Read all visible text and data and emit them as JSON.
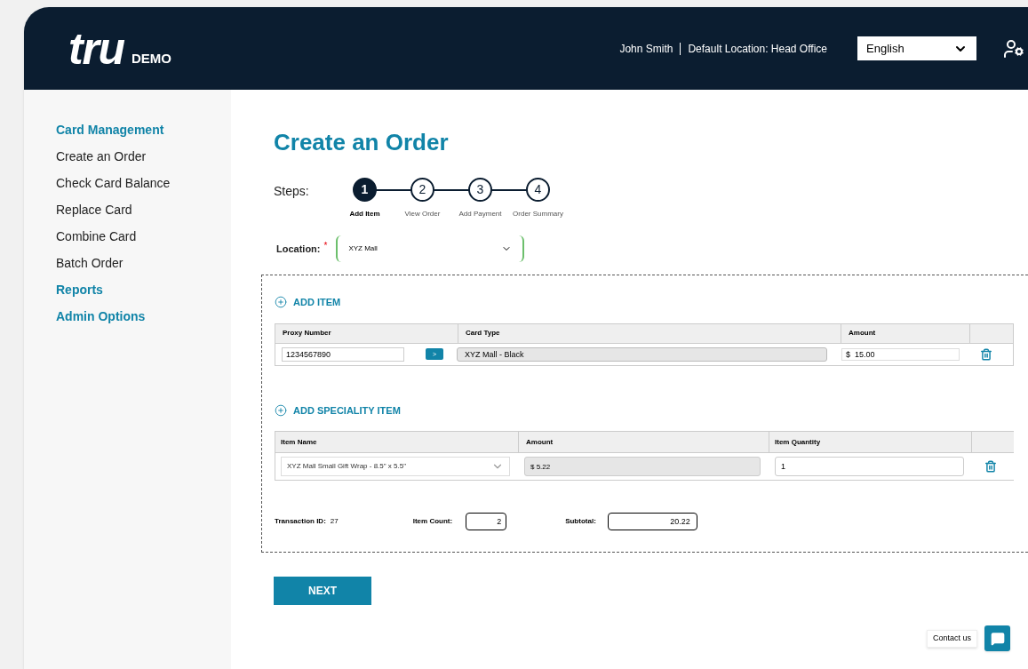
{
  "header": {
    "logo": "tru",
    "logo_sub": "DEMO",
    "user": "John Smith",
    "location_label": "Default Location:",
    "location": "Head Office",
    "language": "English"
  },
  "sidebar": {
    "items": [
      {
        "label": "Card Management",
        "kind": "heading"
      },
      {
        "label": "Create an Order",
        "kind": "link"
      },
      {
        "label": "Check Card Balance",
        "kind": "link"
      },
      {
        "label": "Replace Card",
        "kind": "link"
      },
      {
        "label": "Combine Card",
        "kind": "link"
      },
      {
        "label": "Batch Order",
        "kind": "link"
      },
      {
        "label": "Reports",
        "kind": "heading"
      },
      {
        "label": "Admin Options",
        "kind": "heading"
      }
    ]
  },
  "page_title": "Create an Order",
  "steps": {
    "label": "Steps:",
    "items": [
      {
        "number": "1",
        "label": "Add Item",
        "selected": true
      },
      {
        "number": "2",
        "label": "View Order",
        "selected": false
      },
      {
        "number": "3",
        "label": "Add Payment",
        "selected": false
      },
      {
        "number": "4",
        "label": "Order Summary",
        "selected": false
      }
    ]
  },
  "location": {
    "label": "Location:",
    "required_mark": "*",
    "value": "XYZ Mall"
  },
  "add_item": {
    "title": "ADD ITEM",
    "columns": [
      "Proxy Number",
      "Card Type",
      "Amount"
    ],
    "go_button": ">",
    "rows": [
      {
        "proxy_number": "1234567890",
        "card_type": "XYZ Mall - Black",
        "amount": "$  15.00"
      }
    ]
  },
  "add_speciality_item": {
    "title": "ADD SPECIALITY ITEM",
    "columns": [
      "Item Name",
      "Amount",
      "Item Quantity"
    ],
    "rows": [
      {
        "item_name": "XYZ Mall Small Gift Wrap - 8.5\" x 5.5\"",
        "amount": "$ 5.22",
        "quantity": "1"
      }
    ]
  },
  "totals": {
    "transaction_id_label": "Transaction ID:",
    "transaction_id": "27",
    "item_count_label": "Item Count:",
    "item_count": "2",
    "subtotal_label": "Subtotal:",
    "subtotal": "20.22"
  },
  "next_button": "NEXT",
  "contact": "Contact us"
}
